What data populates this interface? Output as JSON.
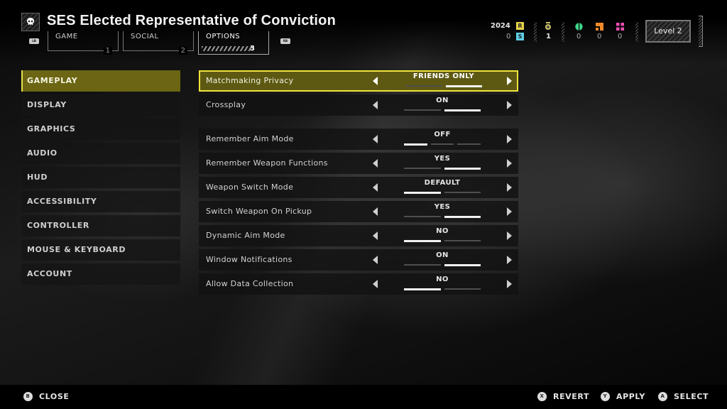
{
  "header": {
    "title": "SES Elected Representative of Conviction",
    "left_bumper": "LB",
    "right_bumper": "RB",
    "tabs": [
      {
        "label": "GAME",
        "number": "1"
      },
      {
        "label": "SOCIAL",
        "number": "2"
      },
      {
        "label": "OPTIONS",
        "number": "3",
        "active": true
      }
    ]
  },
  "stats": {
    "requisition": {
      "value": "2024",
      "badge": "R",
      "color": "#e8d44a"
    },
    "super_credits": {
      "value": "0",
      "badge": "S",
      "color": "#5fd0e8"
    },
    "medals": {
      "value": "1",
      "color": "#c9c06a"
    },
    "green_samples": {
      "value": "0",
      "color": "#3ed88a"
    },
    "orange_samples": {
      "value": "0",
      "color": "#f08a2a"
    },
    "pink_samples": {
      "value": "0",
      "color": "#e84fb0"
    },
    "level": "Level 2"
  },
  "sidebar": {
    "items": [
      {
        "label": "GAMEPLAY",
        "active": true
      },
      {
        "label": "DISPLAY"
      },
      {
        "label": "GRAPHICS"
      },
      {
        "label": "AUDIO"
      },
      {
        "label": "HUD"
      },
      {
        "label": "ACCESSIBILITY"
      },
      {
        "label": "CONTROLLER"
      },
      {
        "label": "MOUSE & KEYBOARD"
      },
      {
        "label": "ACCOUNT"
      }
    ]
  },
  "settings": [
    {
      "label": "Matchmaking Privacy",
      "value": "FRIENDS ONLY",
      "options_count": 2,
      "selected_index": 1,
      "focused": true
    },
    {
      "label": "Crossplay",
      "value": "ON",
      "options_count": 2,
      "selected_index": 1
    },
    {
      "label": "Remember Aim Mode",
      "value": "OFF",
      "options_count": 3,
      "selected_index": 0
    },
    {
      "label": "Remember Weapon Functions",
      "value": "YES",
      "options_count": 2,
      "selected_index": 1
    },
    {
      "label": "Weapon Switch Mode",
      "value": "DEFAULT",
      "options_count": 2,
      "selected_index": 0
    },
    {
      "label": "Switch Weapon On Pickup",
      "value": "YES",
      "options_count": 2,
      "selected_index": 1
    },
    {
      "label": "Dynamic Aim Mode",
      "value": "NO",
      "options_count": 2,
      "selected_index": 0
    },
    {
      "label": "Window Notifications",
      "value": "ON",
      "options_count": 2,
      "selected_index": 1
    },
    {
      "label": "Allow Data Collection",
      "value": "NO",
      "options_count": 2,
      "selected_index": 0
    }
  ],
  "footer": {
    "close": {
      "glyph": "B",
      "label": "CLOSE"
    },
    "revert": {
      "glyph": "X",
      "label": "REVERT"
    },
    "apply": {
      "glyph": "Y",
      "label": "APPLY"
    },
    "select": {
      "glyph": "A",
      "label": "SELECT"
    }
  },
  "colors": {
    "accent_yellow": "#efe53a",
    "active_fill": "#6b6514"
  }
}
